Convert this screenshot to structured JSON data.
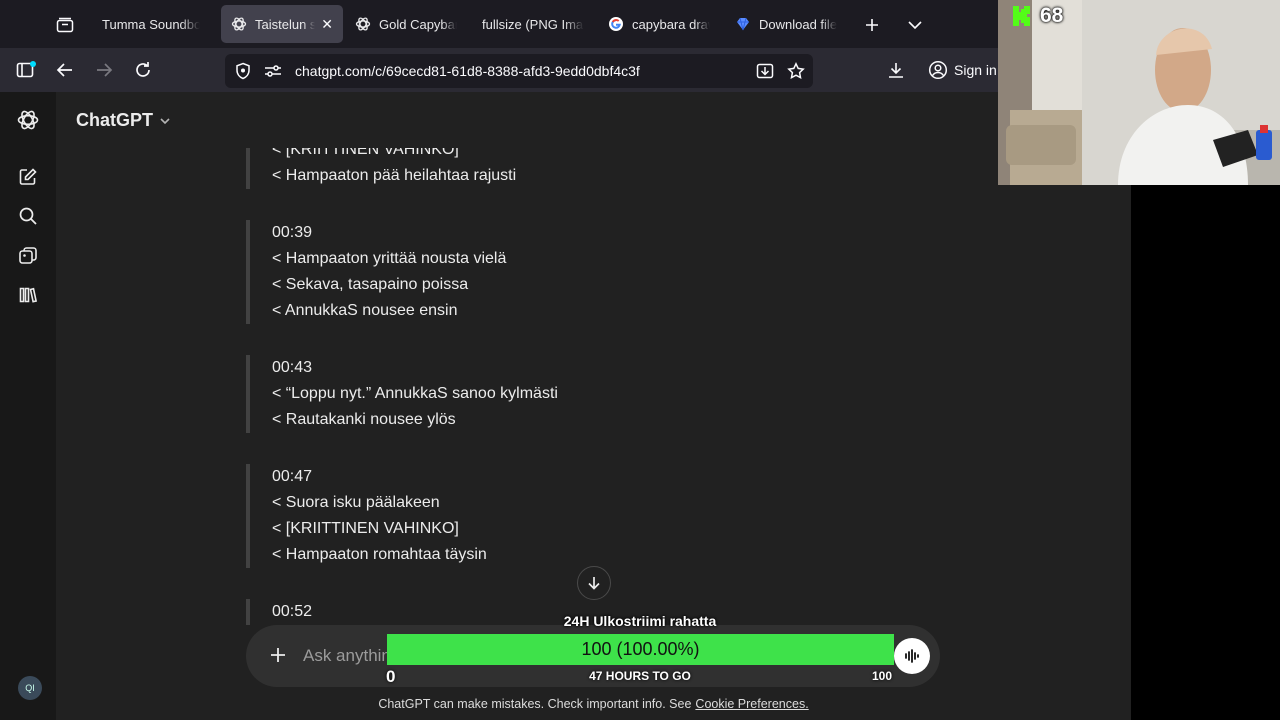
{
  "browser": {
    "tabs": [
      {
        "label": "Tumma Soundboard",
        "active": false,
        "icon": "none"
      },
      {
        "label": "Taistelun simulaatio",
        "active": true,
        "icon": "chatgpt-icon"
      },
      {
        "label": "Gold Capybara",
        "active": false,
        "icon": "chatgpt-icon"
      },
      {
        "label": "fullsize (PNG Image)",
        "active": false,
        "icon": "none"
      },
      {
        "label": "capybara drawing",
        "active": false,
        "icon": "google-icon"
      },
      {
        "label": "Download file",
        "active": false,
        "icon": "gem-icon"
      }
    ],
    "url": "chatgpt.com/c/69cecd81-61d8-8388-afd3-9edd0dbf4c3f",
    "sign_in_label": "Sign in"
  },
  "chatgpt": {
    "model_label": "ChatGPT",
    "composer_placeholder": "Ask anything",
    "disclaimer_text": "ChatGPT can make mistakes. Check important info. See",
    "disclaimer_link": "Cookie Preferences.",
    "avatar_initials": "QI"
  },
  "chat_blocks": [
    {
      "time": "",
      "lines": [
        "< [KRIITTINEN VAHINKO]",
        "< Hampaaton pää heilahtaa rajusti"
      ]
    },
    {
      "time": "00:39",
      "lines": [
        "< Hampaaton yrittää nousta vielä",
        "< Sekava, tasapaino poissa",
        "< AnnukkaS nousee ensin"
      ]
    },
    {
      "time": "00:43",
      "lines": [
        "< “Loppu nyt.” AnnukkaS sanoo kylmästi",
        "< Rautakanki nousee ylös"
      ]
    },
    {
      "time": "00:47",
      "lines": [
        "< Suora isku päälakeen",
        "< [KRIITTINEN VAHINKO]",
        "< Hampaaton romahtaa täysin"
      ]
    },
    {
      "time": "00:52",
      "lines": []
    }
  ],
  "overlay": {
    "goal_title": "24H Ulkostriimi rahatta",
    "goal_value_text": "100 (100.00%)",
    "goal_progress": 1.0,
    "goal_min": "0",
    "goal_max": "100",
    "goal_subtitle": "47 HOURS TO GO",
    "kick_count": "68",
    "colors": {
      "goal_fill": "#3ee24a",
      "kick_green": "#53fc18"
    }
  }
}
